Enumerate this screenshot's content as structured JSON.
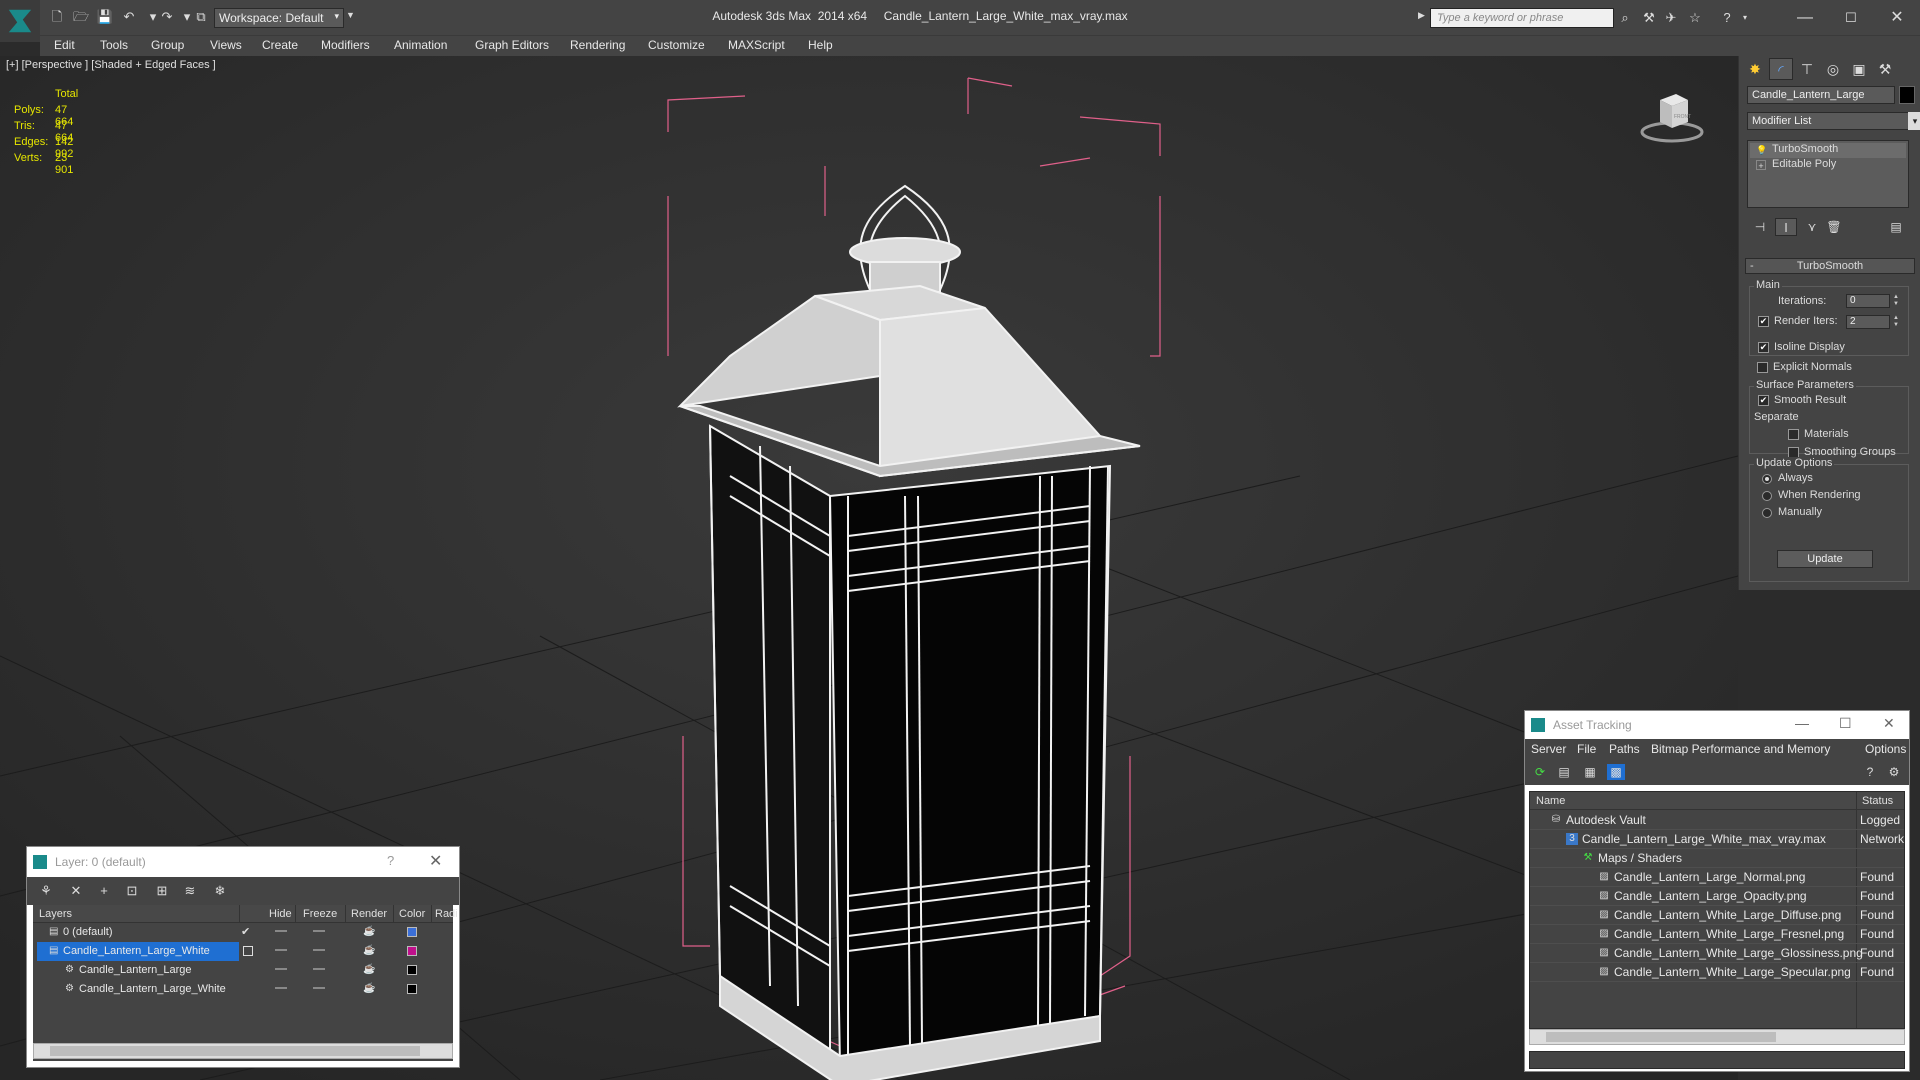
{
  "titlebar": {
    "workspace": "Workspace: Default",
    "title": "Autodesk 3ds Max  2014 x64     Candle_Lantern_Large_White_max_vray.max",
    "search_placeholder": "Type a keyword or phrase"
  },
  "menu": [
    "Edit",
    "Tools",
    "Group",
    "Views",
    "Create",
    "Modifiers",
    "Animation",
    "Graph Editors",
    "Rendering",
    "Customize",
    "MAXScript",
    "Help"
  ],
  "viewport": {
    "label": "[+] [Perspective ] [Shaded + Edged Faces ]",
    "stats": {
      "header": "Total",
      "rows": [
        {
          "label": "Polys:",
          "value": "47 664"
        },
        {
          "label": "Tris:",
          "value": "47 664"
        },
        {
          "label": "Edges:",
          "value": "142 992"
        },
        {
          "label": "Verts:",
          "value": "23 901"
        }
      ]
    },
    "viewcube_label": "FRONT"
  },
  "command_panel": {
    "object_name": "Candle_Lantern_Large",
    "modifier_list": "Modifier List",
    "stack": [
      "TurboSmooth",
      "Editable Poly"
    ],
    "turbosmooth": {
      "title": "TurboSmooth",
      "main": "Main",
      "iterations_label": "Iterations:",
      "iterations": "0",
      "render_iters_label": "Render Iters:",
      "render_iters": "2",
      "isoline": "Isoline Display",
      "explicit": "Explicit Normals",
      "surface": "Surface Parameters",
      "smooth_result": "Smooth Result",
      "separate": "Separate",
      "materials": "Materials",
      "smoothing_groups": "Smoothing Groups",
      "update_options": "Update Options",
      "always": "Always",
      "when_rendering": "When Rendering",
      "manually": "Manually",
      "update": "Update"
    }
  },
  "layer_window": {
    "title": "Layer: 0 (default)",
    "help": "?",
    "columns": [
      "Layers",
      "Hide",
      "Freeze",
      "Render",
      "Color",
      "Radi"
    ],
    "rows": [
      {
        "name": "0 (default)",
        "color": "#3b6fd8"
      },
      {
        "name": "Candle_Lantern_Large_White",
        "color": "#c0108c"
      },
      {
        "name": "Candle_Lantern_Large",
        "color": "#000000"
      },
      {
        "name": "Candle_Lantern_Large_White",
        "color": "#000000"
      }
    ]
  },
  "asset_window": {
    "title": "Asset Tracking",
    "menu": [
      "Server",
      "File",
      "Paths",
      "Bitmap Performance and Memory",
      "Options"
    ],
    "columns": [
      "Name",
      "Status"
    ],
    "rows": [
      {
        "name": "Autodesk Vault",
        "status": "Logged O"
      },
      {
        "name": "Candle_Lantern_Large_White_max_vray.max",
        "status": "Network"
      },
      {
        "name": "Maps / Shaders",
        "status": ""
      },
      {
        "name": "Candle_Lantern_Large_Normal.png",
        "status": "Found"
      },
      {
        "name": "Candle_Lantern_Large_Opacity.png",
        "status": "Found"
      },
      {
        "name": "Candle_Lantern_White_Large_Diffuse.png",
        "status": "Found"
      },
      {
        "name": "Candle_Lantern_White_Large_Fresnel.png",
        "status": "Found"
      },
      {
        "name": "Candle_Lantern_White_Large_Glossiness.png",
        "status": "Found"
      },
      {
        "name": "Candle_Lantern_White_Large_Specular.png",
        "status": "Found"
      }
    ]
  }
}
